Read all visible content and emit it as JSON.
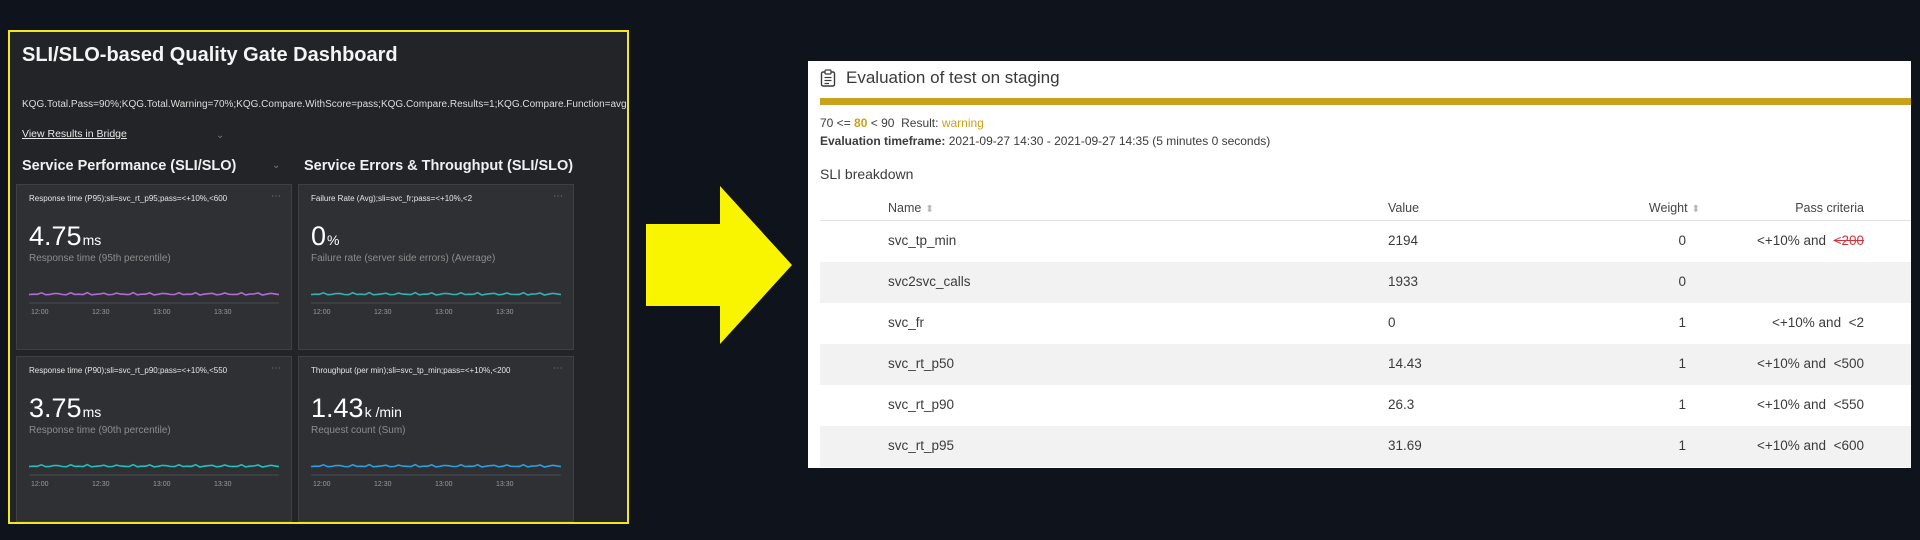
{
  "dashboard": {
    "title": "SLI/SLO-based Quality Gate Dashboard",
    "criteria": "KQG.Total.Pass=90%;KQG.Total.Warning=70%;KQG.Compare.WithScore=pass;KQG.Compare.Results=1;KQG.Compare.Function=avg",
    "link_label": "View Results in Bridge",
    "sections": [
      {
        "title": "Service Performance (SLI/SLO)"
      },
      {
        "title": "Service Errors & Throughput (SLI/SLO)"
      }
    ],
    "tiles": [
      {
        "header": "Response time (P95);sli=svc_rt_p95;pass=<+10%,<600",
        "value": "4.75",
        "unit": "ms",
        "subtitle": "Response time (95th percentile)",
        "color": "#b36ad6",
        "ticks": [
          "12:00",
          "12:30",
          "13:00",
          "13:30"
        ]
      },
      {
        "header": "Failure Rate (Avg);sli=svc_fr;pass=<+10%,<2",
        "value": "0",
        "unit": "%",
        "subtitle": "Failure rate (server side errors) (Average)",
        "color": "#2fb3b3",
        "ticks": [
          "12:00",
          "12:30",
          "13:00",
          "13:30"
        ]
      },
      {
        "header": "Response time (P90);sli=svc_rt_p90;pass=<+10%,<550",
        "value": "3.75",
        "unit": "ms",
        "subtitle": "Response time (90th percentile)",
        "color": "#1ec0c0",
        "ticks": [
          "12:00",
          "12:30",
          "13:00",
          "13:30"
        ]
      },
      {
        "header": "Throughput (per min);sli=svc_tp_min;pass=<+10%,<200",
        "value": "1.43",
        "unit": "k /min",
        "subtitle": "Request count (Sum)",
        "color": "#2a9fe0",
        "ticks": [
          "12:00",
          "12:30",
          "13:00",
          "13:30"
        ]
      }
    ]
  },
  "evaluation": {
    "title": "Evaluation of test on staging",
    "range_prefix": "70 <=",
    "score": "80",
    "range_suffix": "< 90",
    "result_label": "Result:",
    "result": "warning",
    "timeframe_label": "Evaluation timeframe:",
    "timeframe": "2021-09-27 14:30 - 2021-09-27 14:35 (5 minutes 0 seconds)",
    "sli_heading": "SLI breakdown",
    "columns": {
      "name": "Name",
      "value": "Value",
      "weight": "Weight",
      "criteria": "Pass criteria"
    },
    "rows": [
      {
        "name": "svc_tp_min",
        "value": "2194",
        "weight": "0",
        "criteria": "<+10% and",
        "threshold": "<200",
        "failed": true
      },
      {
        "name": "svc2svc_calls",
        "value": "1933",
        "weight": "0",
        "criteria": "",
        "threshold": "",
        "failed": false
      },
      {
        "name": "svc_fr",
        "value": "0",
        "weight": "1",
        "criteria": "<+10% and",
        "threshold": "<2",
        "failed": false
      },
      {
        "name": "svc_rt_p50",
        "value": "14.43",
        "weight": "1",
        "criteria": "<+10% and",
        "threshold": "<500",
        "failed": false
      },
      {
        "name": "svc_rt_p90",
        "value": "26.3",
        "weight": "1",
        "criteria": "<+10% and",
        "threshold": "<550",
        "failed": false
      },
      {
        "name": "svc_rt_p95",
        "value": "31.69",
        "weight": "1",
        "criteria": "<+10% and",
        "threshold": "<600",
        "failed": false
      }
    ]
  },
  "colors": {
    "accent": "#c9a21d",
    "arrow": "#f9f400",
    "highlight_border": "#f2e61e",
    "failed": "#d0333e"
  }
}
